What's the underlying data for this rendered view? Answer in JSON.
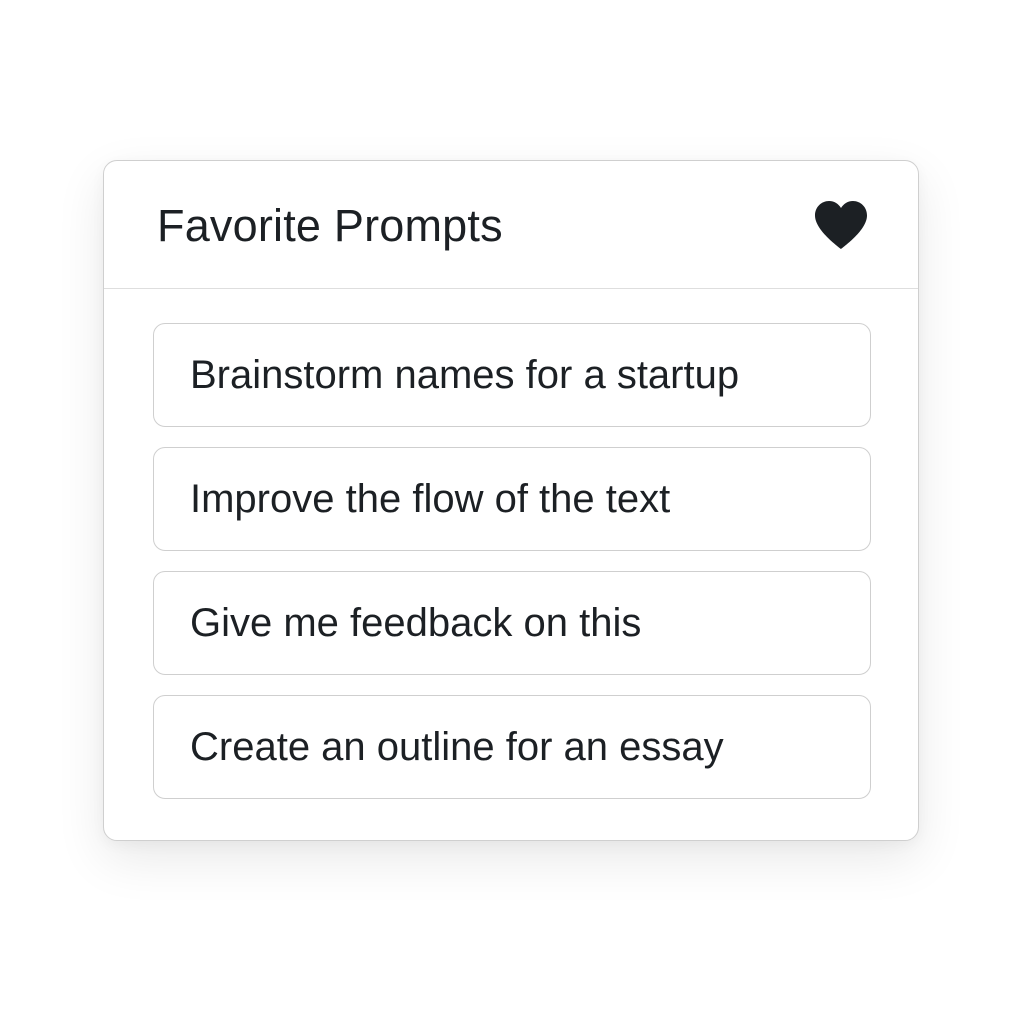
{
  "panel": {
    "title": "Favorite Prompts",
    "favorite_icon": "heart-icon",
    "favorite_icon_color": "#1c2024"
  },
  "prompts": [
    {
      "label": "Brainstorm names for a startup"
    },
    {
      "label": "Improve the flow of the text"
    },
    {
      "label": "Give me feedback on this"
    },
    {
      "label": "Create an outline for an essay"
    }
  ]
}
